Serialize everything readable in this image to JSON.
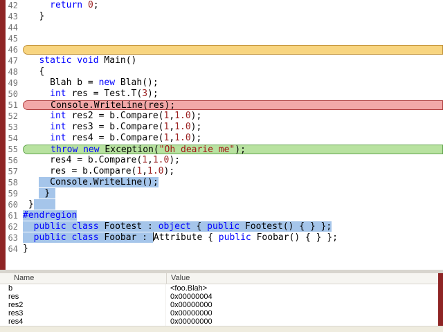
{
  "colors": {
    "keyword": "#0000ff",
    "number": "#9b2121",
    "string": "#a31515",
    "directive": "#0000ff",
    "selection": "#a5c5ea",
    "gutter_text": "#757575",
    "left_strip": "#8e2424",
    "divider": "#d8d5ce",
    "watch_header_bg": "#f6f5f1",
    "bottom_strip": "#efecdf",
    "hl_orange_bg": "#f8d580",
    "hl_orange_border": "#c09138",
    "hl_red_bg": "#f2a8a8",
    "hl_red_border": "#b04040",
    "hl_green_bg": "#b8e2a0",
    "hl_green_border": "#63a54f"
  },
  "editor": {
    "lines": [
      {
        "num": "42",
        "hl": null,
        "tokens": [
          [
            "     ",
            "p"
          ],
          [
            "return",
            "k"
          ],
          [
            " ",
            "p"
          ],
          [
            "0",
            "n"
          ],
          [
            ";",
            "p"
          ]
        ]
      },
      {
        "num": "43",
        "hl": null,
        "tokens": [
          [
            "   ",
            "p"
          ],
          [
            "}",
            "p"
          ]
        ]
      },
      {
        "num": "44",
        "hl": null,
        "tokens": []
      },
      {
        "num": "45",
        "hl": null,
        "tokens": []
      },
      {
        "num": "46",
        "hl": "orange",
        "tokens": []
      },
      {
        "num": "47",
        "hl": null,
        "tokens": [
          [
            "   ",
            "p"
          ],
          [
            "static",
            "k"
          ],
          [
            " ",
            "p"
          ],
          [
            "void",
            "k"
          ],
          [
            " Main()",
            "p"
          ]
        ]
      },
      {
        "num": "48",
        "hl": null,
        "tokens": [
          [
            "   ",
            "p"
          ],
          [
            "{",
            "p"
          ]
        ]
      },
      {
        "num": "49",
        "hl": null,
        "tokens": [
          [
            "     Blah b = ",
            "p"
          ],
          [
            "new",
            "k"
          ],
          [
            " Blah();",
            "p"
          ]
        ]
      },
      {
        "num": "50",
        "hl": null,
        "tokens": [
          [
            "     ",
            "p"
          ],
          [
            "int",
            "k"
          ],
          [
            " res = Test.T(",
            "p"
          ],
          [
            "3",
            "n"
          ],
          [
            ");",
            "p"
          ]
        ]
      },
      {
        "num": "51",
        "hl": "red",
        "tokens": [
          [
            "     Console.WriteLine(res);",
            "p"
          ]
        ]
      },
      {
        "num": "52",
        "hl": null,
        "tokens": [
          [
            "     ",
            "p"
          ],
          [
            "int",
            "k"
          ],
          [
            " res2 = b.Compare(",
            "p"
          ],
          [
            "1",
            "n"
          ],
          [
            ",",
            "p"
          ],
          [
            "1.0",
            "n"
          ],
          [
            ");",
            "p"
          ]
        ]
      },
      {
        "num": "53",
        "hl": null,
        "tokens": [
          [
            "     ",
            "p"
          ],
          [
            "int",
            "k"
          ],
          [
            " res3 = b.Compare(",
            "p"
          ],
          [
            "1",
            "n"
          ],
          [
            ",",
            "p"
          ],
          [
            "1.0",
            "n"
          ],
          [
            ");",
            "p"
          ]
        ]
      },
      {
        "num": "54",
        "hl": null,
        "tokens": [
          [
            "     ",
            "p"
          ],
          [
            "int",
            "k"
          ],
          [
            " res4 = b.Compare(",
            "p"
          ],
          [
            "1",
            "n"
          ],
          [
            ",",
            "p"
          ],
          [
            "1.0",
            "n"
          ],
          [
            ");",
            "p"
          ]
        ]
      },
      {
        "num": "55",
        "hl": "green",
        "tokens": [
          [
            "     ",
            "p"
          ],
          [
            "throw",
            "k"
          ],
          [
            " ",
            "p"
          ],
          [
            "new",
            "k"
          ],
          [
            " Exception(",
            "p"
          ],
          [
            "\"Oh dearie me\"",
            "s"
          ],
          [
            ");",
            "p"
          ]
        ]
      },
      {
        "num": "56",
        "hl": null,
        "tokens": [
          [
            "     res4 = b.Compare(",
            "p"
          ],
          [
            "1",
            "n"
          ],
          [
            ",",
            "p"
          ],
          [
            "1.0",
            "n"
          ],
          [
            ");",
            "p"
          ]
        ]
      },
      {
        "num": "57",
        "hl": null,
        "tokens": [
          [
            "     res = b.Compare(",
            "p"
          ],
          [
            "1",
            "n"
          ],
          [
            ",",
            "p"
          ],
          [
            "1.0",
            "n"
          ],
          [
            ");",
            "p"
          ]
        ]
      },
      {
        "num": "58",
        "hl": null,
        "tokens": [
          [
            "   ",
            "p"
          ],
          [
            "  Console.WriteLine();",
            "p",
            1
          ]
        ]
      },
      {
        "num": "59",
        "hl": null,
        "tokens": [
          [
            "   ",
            "p"
          ],
          [
            " } ",
            "p",
            1
          ]
        ]
      },
      {
        "num": "60",
        "hl": null,
        "tokens": [
          [
            " }",
            "p"
          ],
          [
            "    ",
            "p",
            1
          ]
        ]
      },
      {
        "num": "61",
        "hl": null,
        "tokens": [
          [
            "#endregion",
            "d",
            1
          ]
        ]
      },
      {
        "num": "62",
        "hl": null,
        "tokens": [
          [
            "  ",
            "p",
            1
          ],
          [
            "public",
            "k",
            1
          ],
          [
            " ",
            "p",
            1
          ],
          [
            "class",
            "k",
            1
          ],
          [
            " Footest : ",
            "p",
            1
          ],
          [
            "object",
            "k",
            1
          ],
          [
            " { ",
            "p",
            1
          ],
          [
            "public",
            "k",
            1
          ],
          [
            " Footest() { } };",
            "p",
            1
          ]
        ]
      },
      {
        "num": "63",
        "hl": null,
        "tokens": [
          [
            "  ",
            "p",
            1
          ],
          [
            "public",
            "k",
            1
          ],
          [
            " ",
            "p",
            1
          ],
          [
            "class",
            "k",
            1
          ],
          [
            " Foobar : ",
            "p",
            1
          ],
          [
            "",
            "c"
          ],
          [
            "Attribute { ",
            "p"
          ],
          [
            "public",
            "k"
          ],
          [
            " Foobar() { } };",
            "p"
          ]
        ]
      },
      {
        "num": "64",
        "hl": null,
        "tokens": [
          [
            "}",
            "p"
          ]
        ]
      }
    ]
  },
  "watch": {
    "columns": [
      "Name",
      "Value"
    ],
    "rows": [
      {
        "name": "b",
        "value": "<foo.Blah>"
      },
      {
        "name": "res",
        "value": "0x00000004"
      },
      {
        "name": "res2",
        "value": "0x00000000"
      },
      {
        "name": "res3",
        "value": "0x00000000"
      },
      {
        "name": "res4",
        "value": "0x00000000"
      }
    ]
  }
}
